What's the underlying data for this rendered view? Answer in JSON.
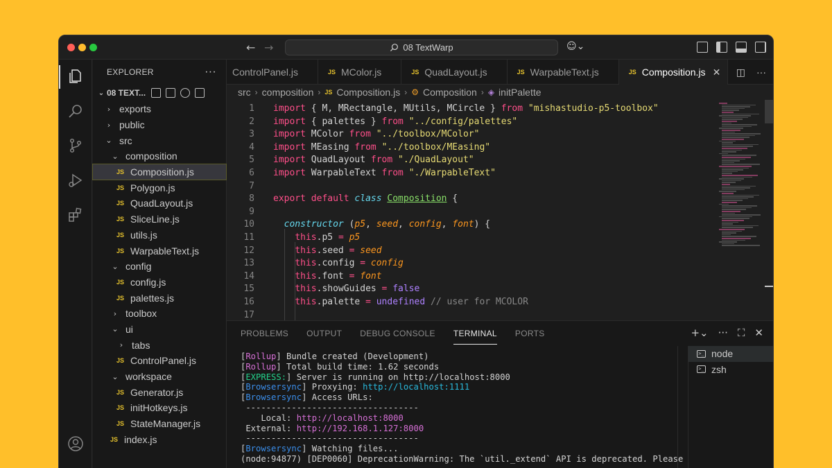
{
  "titlebar": {
    "search_text": "08 TextWarp"
  },
  "sidebar": {
    "title": "EXPLORER",
    "project": "08 TEXT...",
    "tree": [
      {
        "label": "exports",
        "type": "folder",
        "open": false,
        "depth": 0
      },
      {
        "label": "public",
        "type": "folder",
        "open": false,
        "depth": 0
      },
      {
        "label": "src",
        "type": "folder",
        "open": true,
        "depth": 0
      },
      {
        "label": "composition",
        "type": "folder",
        "open": true,
        "depth": 1
      },
      {
        "label": "Composition.js",
        "type": "file",
        "depth": 2,
        "selected": true
      },
      {
        "label": "Polygon.js",
        "type": "file",
        "depth": 2
      },
      {
        "label": "QuadLayout.js",
        "type": "file",
        "depth": 2
      },
      {
        "label": "SliceLine.js",
        "type": "file",
        "depth": 2
      },
      {
        "label": "utils.js",
        "type": "file",
        "depth": 2
      },
      {
        "label": "WarpableText.js",
        "type": "file",
        "depth": 2
      },
      {
        "label": "config",
        "type": "folder",
        "open": true,
        "depth": 1
      },
      {
        "label": "config.js",
        "type": "file",
        "depth": 2
      },
      {
        "label": "palettes.js",
        "type": "file",
        "depth": 2
      },
      {
        "label": "toolbox",
        "type": "folder",
        "open": false,
        "depth": 1
      },
      {
        "label": "ui",
        "type": "folder",
        "open": true,
        "depth": 1
      },
      {
        "label": "tabs",
        "type": "folder",
        "open": false,
        "depth": 2
      },
      {
        "label": "ControlPanel.js",
        "type": "file",
        "depth": 2
      },
      {
        "label": "workspace",
        "type": "folder",
        "open": true,
        "depth": 1
      },
      {
        "label": "Generator.js",
        "type": "file",
        "depth": 2
      },
      {
        "label": "initHotkeys.js",
        "type": "file",
        "depth": 2
      },
      {
        "label": "StateManager.js",
        "type": "file",
        "depth": 2
      },
      {
        "label": "index.js",
        "type": "file",
        "depth": 1
      }
    ]
  },
  "tabs": [
    {
      "label": "ControlPanel.js",
      "active": false,
      "icon": false
    },
    {
      "label": "MColor.js",
      "active": false,
      "icon": true
    },
    {
      "label": "QuadLayout.js",
      "active": false,
      "icon": true
    },
    {
      "label": "WarpableText.js",
      "active": false,
      "icon": true
    },
    {
      "label": "Composition.js",
      "active": true,
      "icon": true
    }
  ],
  "breadcrumb": {
    "parts": [
      "src",
      "composition",
      "Composition.js",
      "Composition",
      "initPalette"
    ]
  },
  "editor": {
    "lines": [
      [
        [
          "kw",
          "import"
        ],
        [
          "tx",
          " { M, MRectangle, MUtils, MCircle } "
        ],
        [
          "kw",
          "from"
        ],
        [
          "tx",
          " "
        ],
        [
          "str",
          "\"mishastudio-p5-toolbox\""
        ]
      ],
      [
        [
          "kw",
          "import"
        ],
        [
          "tx",
          " { palettes } "
        ],
        [
          "kw",
          "from"
        ],
        [
          "tx",
          " "
        ],
        [
          "str",
          "\"../config/palettes\""
        ]
      ],
      [
        [
          "kw",
          "import"
        ],
        [
          "tx",
          " MColor "
        ],
        [
          "kw",
          "from"
        ],
        [
          "tx",
          " "
        ],
        [
          "str",
          "\"../toolbox/MColor\""
        ]
      ],
      [
        [
          "kw",
          "import"
        ],
        [
          "tx",
          " MEasing "
        ],
        [
          "kw",
          "from"
        ],
        [
          "tx",
          " "
        ],
        [
          "str",
          "\"../toolbox/MEasing\""
        ]
      ],
      [
        [
          "kw",
          "import"
        ],
        [
          "tx",
          " QuadLayout "
        ],
        [
          "kw",
          "from"
        ],
        [
          "tx",
          " "
        ],
        [
          "str",
          "\"./QuadLayout\""
        ]
      ],
      [
        [
          "kw",
          "import"
        ],
        [
          "tx",
          " WarpableText "
        ],
        [
          "kw",
          "from"
        ],
        [
          "tx",
          " "
        ],
        [
          "str",
          "\"./WarpableText\""
        ]
      ],
      [],
      [
        [
          "kw",
          "export"
        ],
        [
          "tx",
          " "
        ],
        [
          "kw",
          "default"
        ],
        [
          "tx",
          " "
        ],
        [
          "ctor",
          "class"
        ],
        [
          "tx",
          " "
        ],
        [
          "fn",
          "Composition"
        ],
        [
          "tx",
          " {"
        ]
      ],
      [],
      [
        [
          "tx",
          "  "
        ],
        [
          "ctor",
          "constructor"
        ],
        [
          "tx",
          " ("
        ],
        [
          "param",
          "p5"
        ],
        [
          "tx",
          ", "
        ],
        [
          "param",
          "seed"
        ],
        [
          "tx",
          ", "
        ],
        [
          "param",
          "config"
        ],
        [
          "tx",
          ", "
        ],
        [
          "param",
          "font"
        ],
        [
          "tx",
          ") {"
        ]
      ],
      [
        [
          "tx",
          "    "
        ],
        [
          "this",
          "this"
        ],
        [
          "tx",
          ".p5 "
        ],
        [
          "kw",
          "="
        ],
        [
          "tx",
          " "
        ],
        [
          "param",
          "p5"
        ]
      ],
      [
        [
          "tx",
          "    "
        ],
        [
          "this",
          "this"
        ],
        [
          "tx",
          ".seed "
        ],
        [
          "kw",
          "="
        ],
        [
          "tx",
          " "
        ],
        [
          "param",
          "seed"
        ]
      ],
      [
        [
          "tx",
          "    "
        ],
        [
          "this",
          "this"
        ],
        [
          "tx",
          ".config "
        ],
        [
          "kw",
          "="
        ],
        [
          "tx",
          " "
        ],
        [
          "param",
          "config"
        ]
      ],
      [
        [
          "tx",
          "    "
        ],
        [
          "this",
          "this"
        ],
        [
          "tx",
          ".font "
        ],
        [
          "kw",
          "="
        ],
        [
          "tx",
          " "
        ],
        [
          "param",
          "font"
        ]
      ],
      [
        [
          "tx",
          "    "
        ],
        [
          "this",
          "this"
        ],
        [
          "tx",
          ".showGuides "
        ],
        [
          "kw",
          "="
        ],
        [
          "tx",
          " "
        ],
        [
          "bool",
          "false"
        ]
      ],
      [
        [
          "tx",
          "    "
        ],
        [
          "this",
          "this"
        ],
        [
          "tx",
          ".palette "
        ],
        [
          "kw",
          "="
        ],
        [
          "tx",
          " "
        ],
        [
          "bool",
          "undefined"
        ],
        [
          "tx",
          " "
        ],
        [
          "cmt",
          "// user for MCOLOR"
        ]
      ],
      []
    ]
  },
  "panel": {
    "tabs": [
      {
        "label": "PROBLEMS",
        "active": false
      },
      {
        "label": "OUTPUT",
        "active": false
      },
      {
        "label": "DEBUG CONSOLE",
        "active": false
      },
      {
        "label": "TERMINAL",
        "active": true
      },
      {
        "label": "PORTS",
        "active": false
      }
    ],
    "terminal_lines": [
      [
        [
          "tx",
          "["
        ],
        [
          "tg-magenta",
          "Rollup"
        ],
        [
          "tx",
          "] Bundle created (Development)"
        ]
      ],
      [
        [
          "tx",
          "["
        ],
        [
          "tg-magenta",
          "Rollup"
        ],
        [
          "tx",
          "] Total build time: 1.62 seconds"
        ]
      ],
      [
        [
          "tx",
          "["
        ],
        [
          "tg-green",
          "EXPRESS:"
        ],
        [
          "tx",
          "] Server is running on http://localhost:8000"
        ]
      ],
      [
        [
          "tx",
          "["
        ],
        [
          "tg-blue",
          "Browsersync"
        ],
        [
          "tx",
          "] Proxying: "
        ],
        [
          "tg-cyan",
          "http://localhost:1111"
        ]
      ],
      [
        [
          "tx",
          "["
        ],
        [
          "tg-blue",
          "Browsersync"
        ],
        [
          "tx",
          "] Access URLs:"
        ]
      ],
      [
        [
          "tx",
          " ----------------------------------"
        ]
      ],
      [
        [
          "tx",
          "    Local: "
        ],
        [
          "tg-magenta",
          "http://localhost:8000"
        ]
      ],
      [
        [
          "tx",
          " External: "
        ],
        [
          "tg-magenta",
          "http://192.168.1.127:8000"
        ]
      ],
      [
        [
          "tx",
          " ----------------------------------"
        ]
      ],
      [
        [
          "tx",
          "["
        ],
        [
          "tg-blue",
          "Browsersync"
        ],
        [
          "tx",
          "] Watching files..."
        ]
      ],
      [
        [
          "tx",
          "(node:94877) [DEP0060] DeprecationWarning: The `util._extend` API is deprecated. Please"
        ]
      ]
    ],
    "sessions": [
      {
        "label": "node",
        "active": true
      },
      {
        "label": "zsh",
        "active": false
      }
    ]
  }
}
